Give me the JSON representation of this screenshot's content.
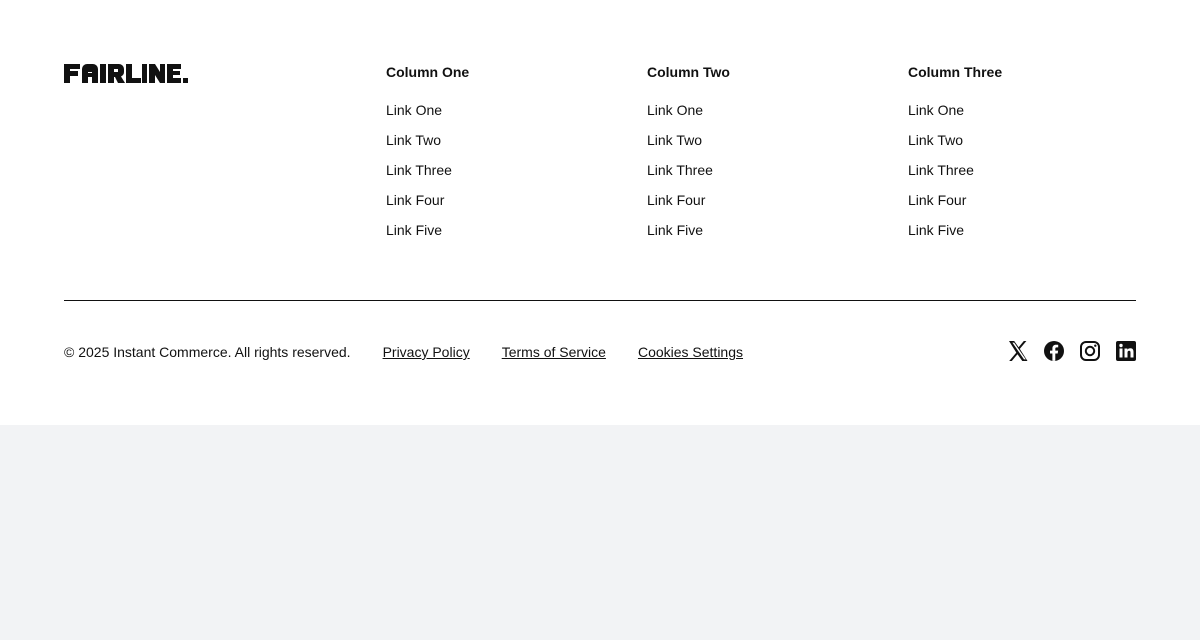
{
  "brand": {
    "logo_text": "FAIRLINE."
  },
  "columns": [
    {
      "title": "Column One",
      "links": [
        "Link One",
        "Link Two",
        "Link Three",
        "Link Four",
        "Link Five"
      ]
    },
    {
      "title": "Column Two",
      "links": [
        "Link One",
        "Link Two",
        "Link Three",
        "Link Four",
        "Link Five"
      ]
    },
    {
      "title": "Column Three",
      "links": [
        "Link One",
        "Link Two",
        "Link Three",
        "Link Four",
        "Link Five"
      ]
    }
  ],
  "bottom": {
    "copyright": "© 2025 Instant Commerce. All rights reserved.",
    "legal_links": [
      "Privacy Policy",
      "Terms of Service",
      "Cookies Settings"
    ]
  },
  "social": {
    "icons": [
      "x-icon",
      "facebook-icon",
      "instagram-icon",
      "linkedin-icon"
    ]
  },
  "colors": {
    "text": "#111111",
    "footer_bg": "#ffffff",
    "page_bg": "#f2f3f5"
  }
}
